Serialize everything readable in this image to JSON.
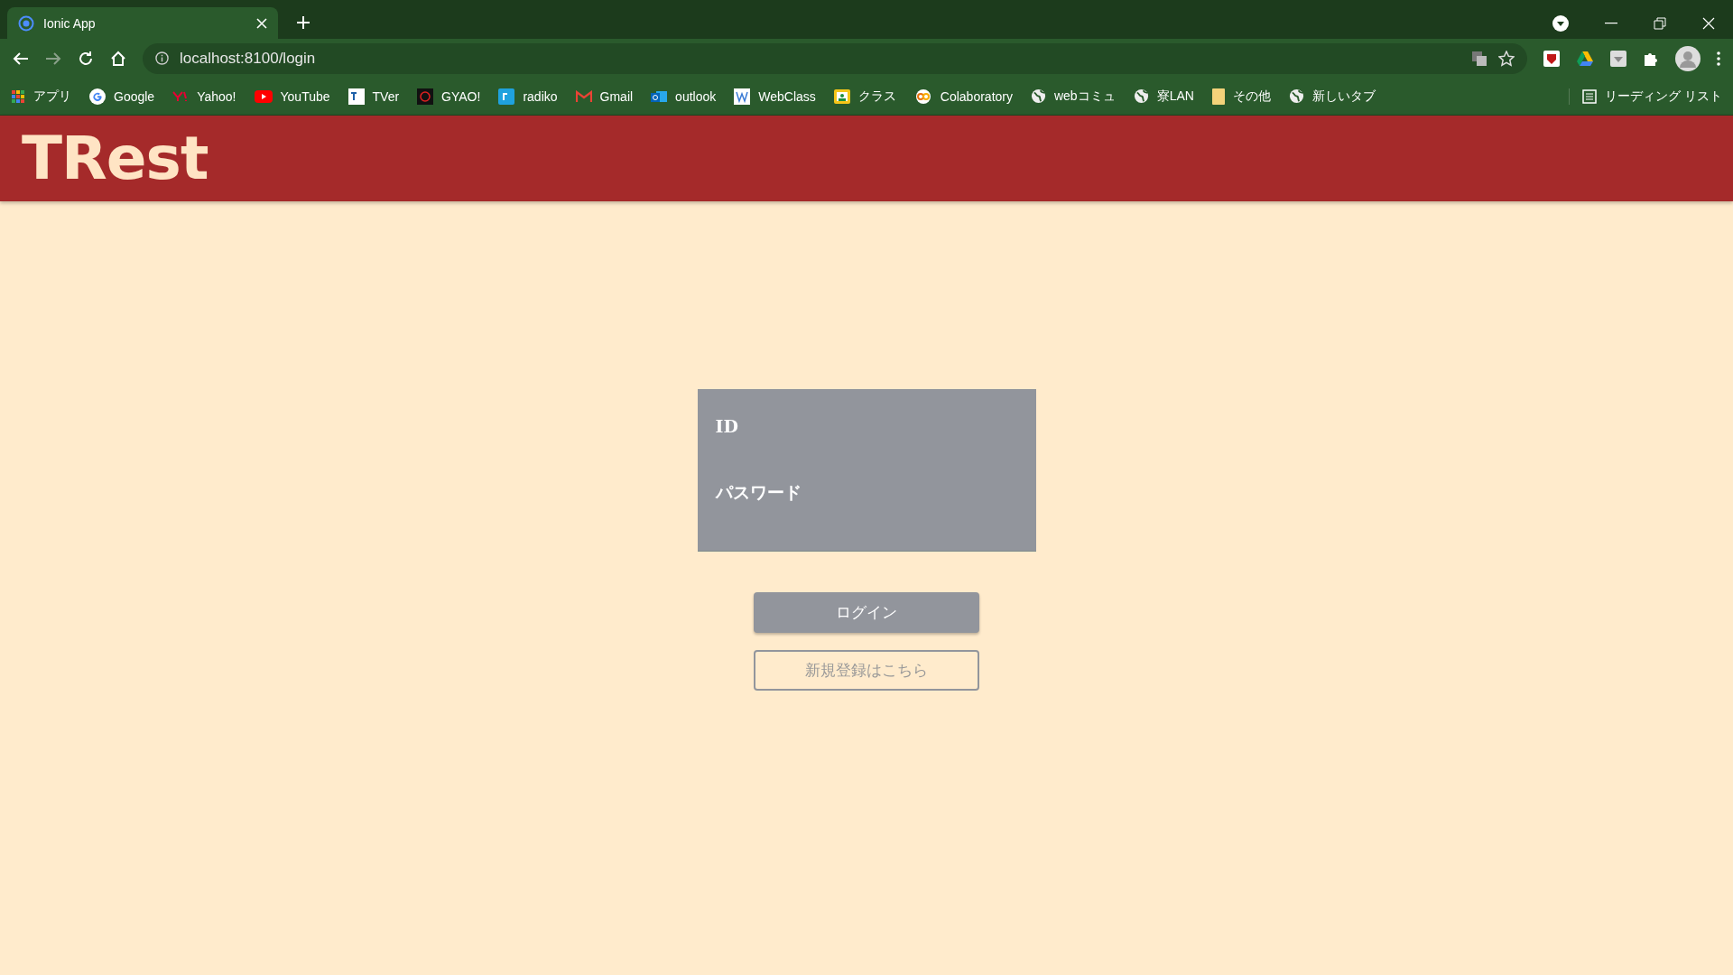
{
  "browser": {
    "tab": {
      "title": "Ionic App"
    },
    "address": "localhost:8100/login",
    "bookmarks": [
      {
        "label": "アプリ"
      },
      {
        "label": "Google"
      },
      {
        "label": "Yahoo!"
      },
      {
        "label": "YouTube"
      },
      {
        "label": "TVer"
      },
      {
        "label": "GYAO!"
      },
      {
        "label": "radiko"
      },
      {
        "label": "Gmail"
      },
      {
        "label": "outlook"
      },
      {
        "label": "WebClass"
      },
      {
        "label": "クラス"
      },
      {
        "label": "Colaboratory"
      },
      {
        "label": "webコミュ"
      },
      {
        "label": "寮LAN"
      },
      {
        "label": "その他"
      },
      {
        "label": "新しいタブ"
      }
    ],
    "reading_list": "リーディング リスト"
  },
  "app": {
    "title": "TRest"
  },
  "login_form": {
    "fields": [
      {
        "label": "ID"
      },
      {
        "label": "パスワード"
      }
    ],
    "buttons": [
      {
        "label": "ログイン",
        "kind": "primary"
      },
      {
        "label": "新規登録はこちら",
        "kind": "outline"
      }
    ]
  }
}
